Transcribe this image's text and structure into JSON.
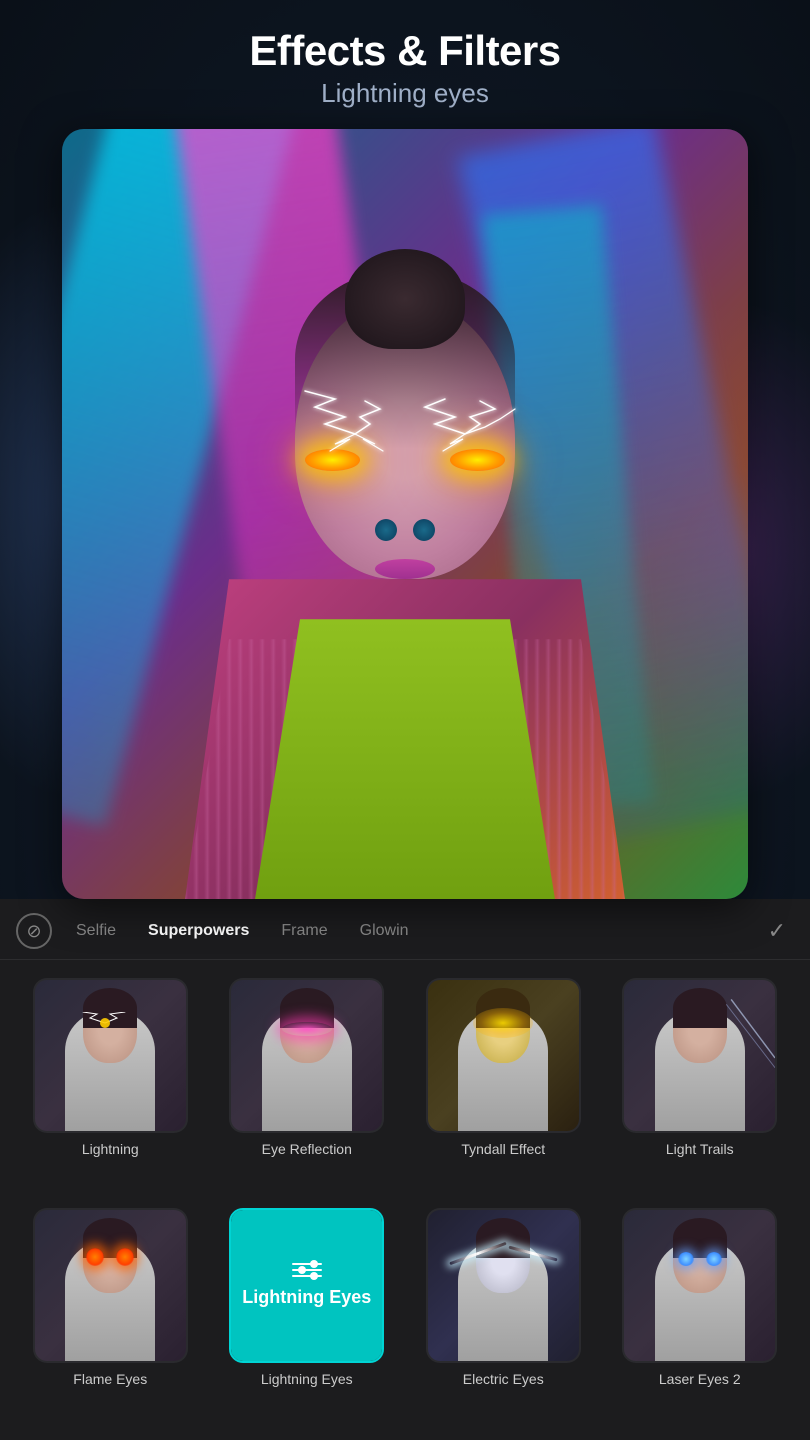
{
  "header": {
    "title": "Effects & Filters",
    "subtitle": "Lightning eyes"
  },
  "tabs": {
    "no_icon_label": "⊘",
    "items": [
      {
        "label": "Selfie",
        "active": false
      },
      {
        "label": "Superpowers",
        "active": true
      },
      {
        "label": "Frame",
        "active": false
      },
      {
        "label": "Glowin",
        "active": false
      }
    ],
    "checkmark": "✓"
  },
  "effects": {
    "row1": [
      {
        "label": "Lightning",
        "type": "lightning",
        "active": false
      },
      {
        "label": "Eye Reflection",
        "type": "eye-reflection",
        "active": false
      },
      {
        "label": "Tyndall Effect",
        "type": "tyndall",
        "active": false
      },
      {
        "label": "Light Trails",
        "type": "light-trails",
        "active": false
      }
    ],
    "row2": [
      {
        "label": "Flame Eyes",
        "type": "flame-eyes",
        "active": false
      },
      {
        "label": "Lightning Eyes",
        "type": "lightning-eyes",
        "active": true
      },
      {
        "label": "Electric Eyes",
        "type": "electric-eyes",
        "active": false
      },
      {
        "label": "Laser Eyes 2",
        "type": "laser-eyes-2",
        "active": false
      }
    ]
  },
  "colors": {
    "active_border": "#00c4c0",
    "adjust_bg": "#00c4c0",
    "tab_active": "#ffffff",
    "tab_inactive": "#888888",
    "bg_panel": "#1c1c1e"
  }
}
